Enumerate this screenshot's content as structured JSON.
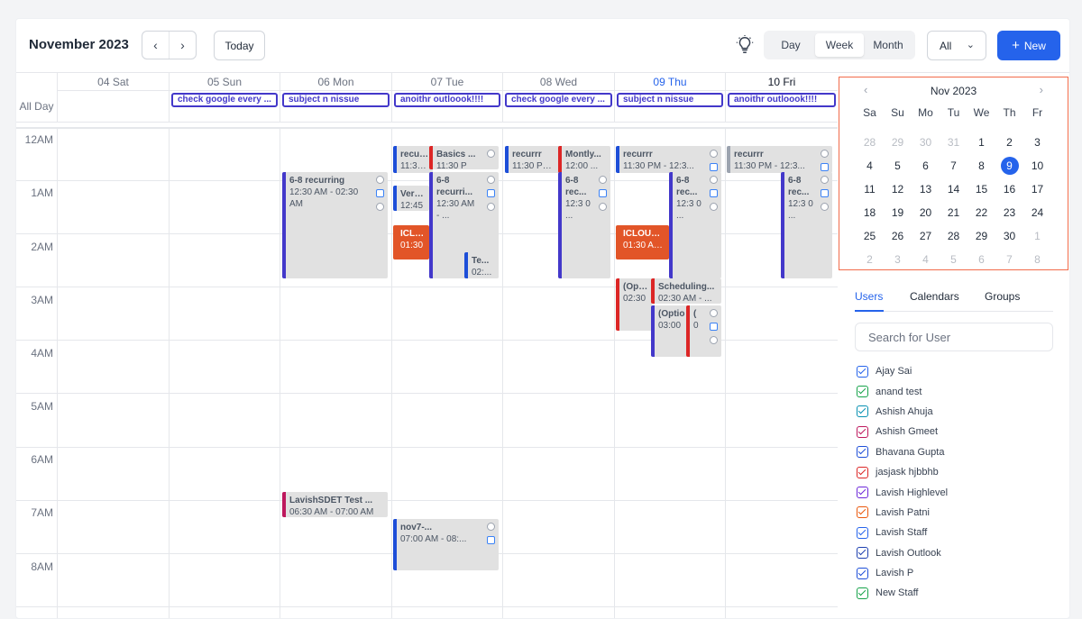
{
  "header": {
    "title": "November 2023",
    "prev_icon": "chevron-left-icon",
    "next_icon": "chevron-right-icon",
    "today_label": "Today",
    "views": [
      "Day",
      "Week",
      "Month"
    ],
    "active_view": "Week",
    "filter_label": "All",
    "new_label": "New"
  },
  "calendar": {
    "days": [
      "04 Sat",
      "05 Sun",
      "06 Mon",
      "07 Tue",
      "08 Wed",
      "09 Thu",
      "10 Fri"
    ],
    "all_day_label": "All Day",
    "all_day_events": [
      "check google every ...",
      "subject n nissue",
      "anoithr outloook!!!!",
      "check google every ...",
      "subject n nissue",
      "anoithr outloook!!!!"
    ],
    "hours": [
      "12AM",
      "1AM",
      "2AM",
      "3AM",
      "4AM",
      "5AM",
      "6AM",
      "7AM",
      "8AM"
    ],
    "events": [
      {
        "title": "6-8 recurring",
        "sub": "12:30 AM - 02:30 AM"
      },
      {
        "title": "LavishSDET Test ...",
        "sub": "06:30 AM - 07:00 AM"
      },
      {
        "title": "recurrr",
        "sub": "11:30 P"
      },
      {
        "title": "Basics ...",
        "sub": "11:30 P"
      },
      {
        "title": "6-8 recurri...",
        "sub": "12:30 AM - ..."
      },
      {
        "title": "Verifaj",
        "sub": "12:45"
      },
      {
        "title": "ICLOUD",
        "sub": "01:30"
      },
      {
        "title": "Te...",
        "sub": "02:..."
      },
      {
        "title": "nov7-...",
        "sub": "07:00 AM - 08:..."
      },
      {
        "title": "recurrr",
        "sub": "11:30 PM - ..."
      },
      {
        "title": "Montly...",
        "sub": "12:00 ..."
      },
      {
        "title": "6-8 rec...",
        "sub": "12:3 0 ..."
      },
      {
        "title": "recurrr",
        "sub": "11:30 PM - 12:3..."
      },
      {
        "title": "6-8 rec...",
        "sub": "12:3 0 ..."
      },
      {
        "title": "ICLOUD Re",
        "sub": "01:30 AM -"
      },
      {
        "title": "(Optio",
        "sub": "02:30"
      },
      {
        "title": "Scheduling...",
        "sub": "02:30 AM - ..."
      },
      {
        "title": "(Optio",
        "sub": "03:00"
      },
      {
        "title": "(",
        "sub": "0"
      },
      {
        "title": "recurrr",
        "sub": "11:30 PM - 12:3..."
      },
      {
        "title": "6-8 rec...",
        "sub": "12:3 0 ..."
      }
    ]
  },
  "mini_calendar": {
    "month": "Nov 2023",
    "dow": [
      "Sa",
      "Su",
      "Mo",
      "Tu",
      "We",
      "Th",
      "Fr"
    ],
    "weeks": [
      [
        "28",
        "29",
        "30",
        "31",
        "1",
        "2",
        "3"
      ],
      [
        "4",
        "5",
        "6",
        "7",
        "8",
        "9",
        "10"
      ],
      [
        "11",
        "12",
        "13",
        "14",
        "15",
        "16",
        "17"
      ],
      [
        "18",
        "19",
        "20",
        "21",
        "22",
        "23",
        "24"
      ],
      [
        "25",
        "26",
        "27",
        "28",
        "29",
        "30",
        "1"
      ],
      [
        "2",
        "3",
        "4",
        "5",
        "6",
        "7",
        "8"
      ]
    ],
    "selected": "9"
  },
  "side_tabs": [
    "Users",
    "Calendars",
    "Groups"
  ],
  "search_placeholder": "Search for User",
  "users": [
    {
      "name": "Ajay Sai",
      "color": "#2563eb"
    },
    {
      "name": "anand test",
      "color": "#16a34a"
    },
    {
      "name": "Ashish Ahuja",
      "color": "#0891b2"
    },
    {
      "name": "Ashish Gmeet",
      "color": "#be185d"
    },
    {
      "name": "Bhavana Gupta",
      "color": "#1d4ed8"
    },
    {
      "name": "jasjask hjbbhb",
      "color": "#dc2626"
    },
    {
      "name": "Lavish Highlevel",
      "color": "#6d28d9"
    },
    {
      "name": "Lavish Patni",
      "color": "#ea580c"
    },
    {
      "name": "Lavish Staff",
      "color": "#2563eb"
    },
    {
      "name": "Lavish Outlook",
      "color": "#1e40af"
    },
    {
      "name": "Lavish P",
      "color": "#1d4ed8"
    },
    {
      "name": "New Staff",
      "color": "#16a34a"
    }
  ]
}
